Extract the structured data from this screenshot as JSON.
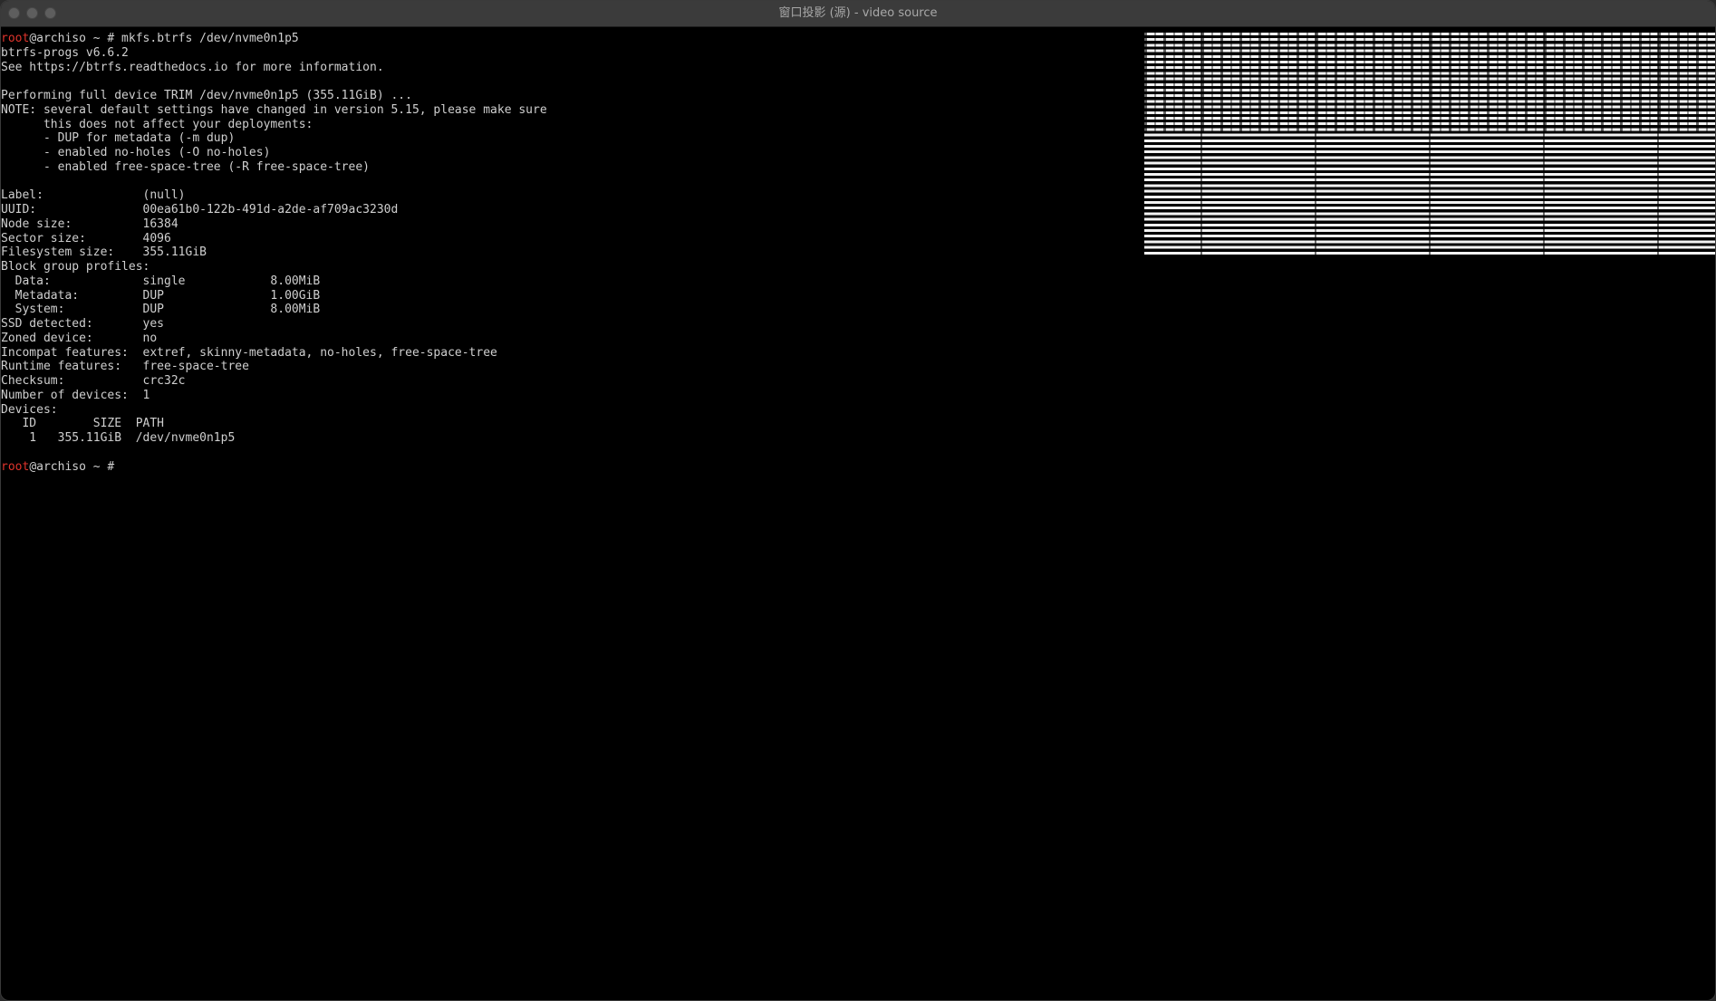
{
  "window": {
    "title": "窗口投影 (源) - video source"
  },
  "terminal": {
    "command_line": {
      "user": "root",
      "host_prompt": "@archiso ~ # mkfs.btrfs /dev/nvme0n1p5"
    },
    "output_lines": [
      "btrfs-progs v6.6.2",
      "See https://btrfs.readthedocs.io for more information.",
      "",
      "Performing full device TRIM /dev/nvme0n1p5 (355.11GiB) ...",
      "NOTE: several default settings have changed in version 5.15, please make sure",
      "      this does not affect your deployments:",
      "      - DUP for metadata (-m dup)",
      "      - enabled no-holes (-O no-holes)",
      "      - enabled free-space-tree (-R free-space-tree)",
      "",
      "Label:              (null)",
      "UUID:               00ea61b0-122b-491d-a2de-af709ac3230d",
      "Node size:          16384",
      "Sector size:        4096",
      "Filesystem size:    355.11GiB",
      "Block group profiles:",
      "  Data:             single            8.00MiB",
      "  Metadata:         DUP               1.00GiB",
      "  System:           DUP               8.00MiB",
      "SSD detected:       yes",
      "Zoned device:       no",
      "Incompat features:  extref, skinny-metadata, no-holes, free-space-tree",
      "Runtime features:   free-space-tree",
      "Checksum:           crc32c",
      "Number of devices:  1",
      "Devices:",
      "   ID        SIZE  PATH",
      "    1   355.11GiB  /dev/nvme0n1p5",
      ""
    ],
    "final_prompt": {
      "user": "root",
      "host_prompt": "@archiso ~ # "
    }
  },
  "colors": {
    "background": "#000000",
    "text": "#cfcfcf",
    "prompt_user": "#e0342c",
    "titlebar": "#3b3b3b"
  }
}
